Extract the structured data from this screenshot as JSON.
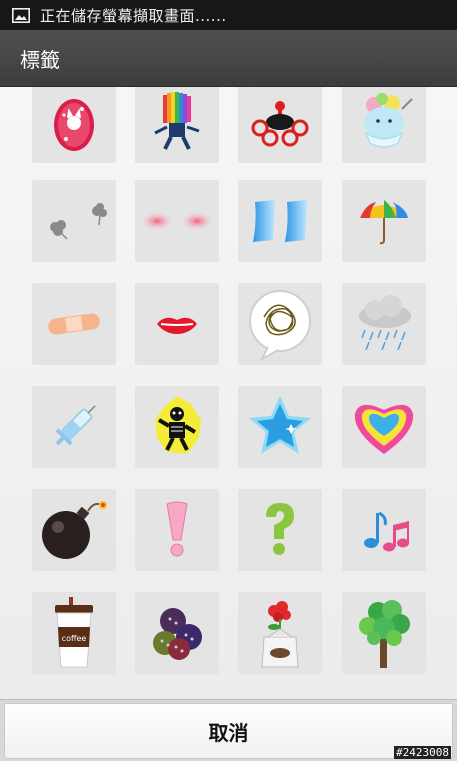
{
  "status_bar": {
    "text": "正在儲存螢幕擷取畫面......",
    "icon": "image-icon"
  },
  "title_bar": {
    "title": "標籤"
  },
  "stickers": [
    {
      "name": "cat-mirror-sticker"
    },
    {
      "name": "afro-runner-sticker"
    },
    {
      "name": "whale-waves-sticker"
    },
    {
      "name": "shaved-ice-sticker"
    },
    {
      "name": "smoke-puffs-sticker"
    },
    {
      "name": "blush-cheeks-sticker"
    },
    {
      "name": "blue-sweat-drops-sticker"
    },
    {
      "name": "umbrella-sticker"
    },
    {
      "name": "bandage-sticker"
    },
    {
      "name": "red-lips-sticker"
    },
    {
      "name": "scribble-speech-bubble-sticker"
    },
    {
      "name": "rain-cloud-sticker"
    },
    {
      "name": "syringe-sticker"
    },
    {
      "name": "electrocuted-skeleton-sticker"
    },
    {
      "name": "blue-star-sticker"
    },
    {
      "name": "rainbow-heart-sticker"
    },
    {
      "name": "bomb-sticker"
    },
    {
      "name": "exclamation-mark-sticker"
    },
    {
      "name": "question-mark-sticker"
    },
    {
      "name": "music-notes-sticker"
    },
    {
      "name": "coffee-cup-sticker"
    },
    {
      "name": "buttons-sticker"
    },
    {
      "name": "flower-pot-sticker"
    },
    {
      "name": "green-tree-sticker"
    }
  ],
  "coffee_label": "coffee",
  "footer": {
    "cancel_label": "取消"
  },
  "watermark": "#2423008"
}
